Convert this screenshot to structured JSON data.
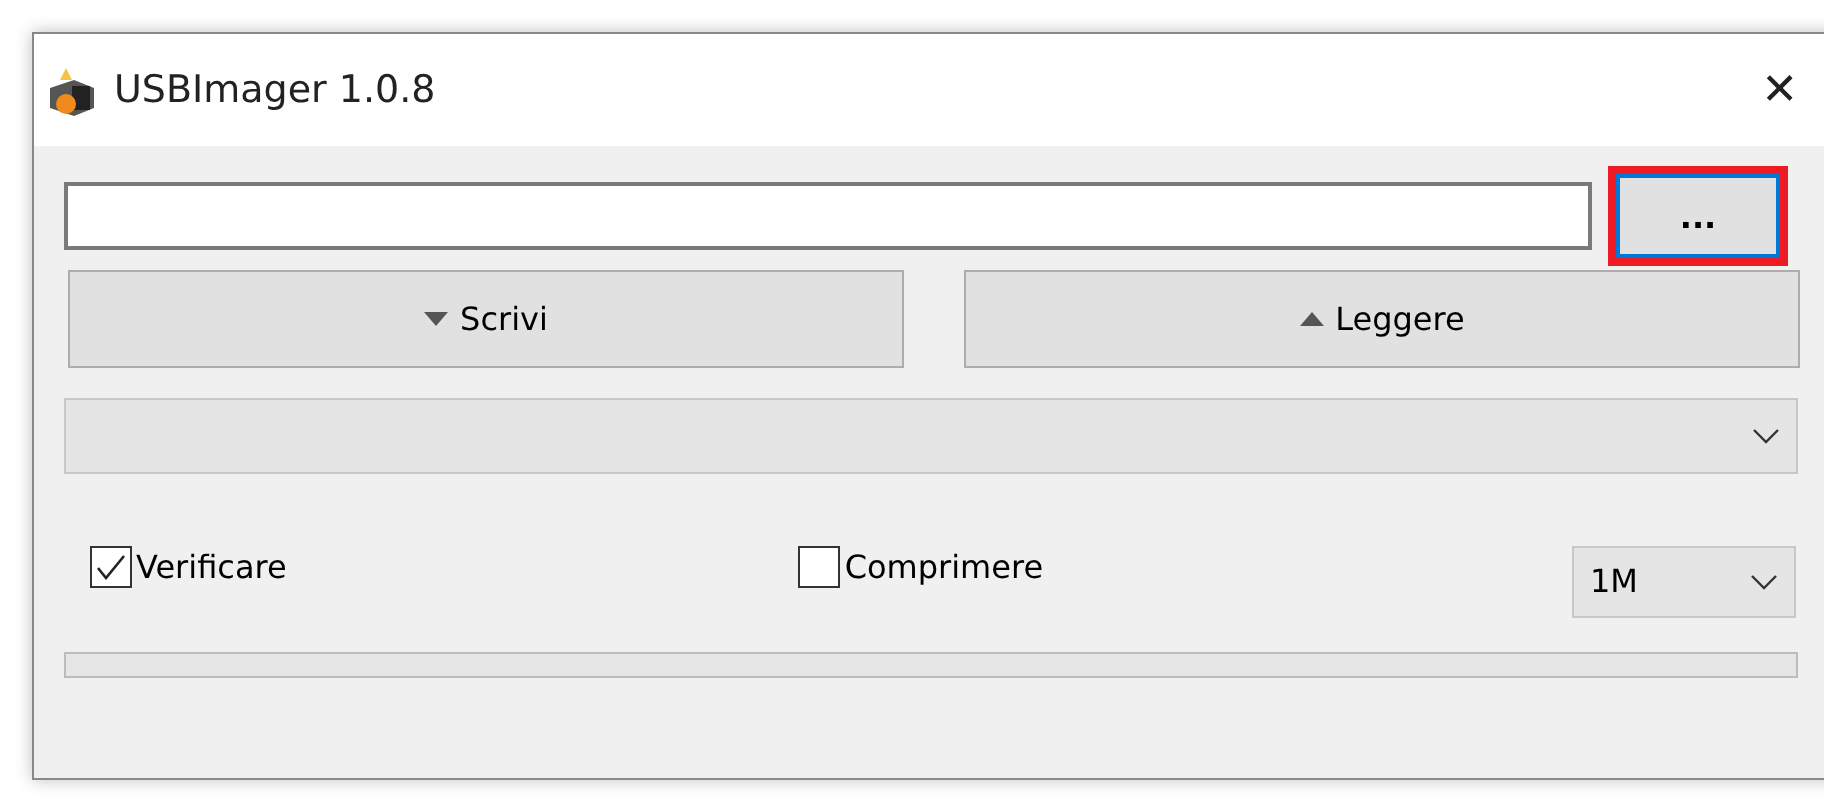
{
  "window": {
    "title": "USBImager 1.0.8",
    "close": "✕"
  },
  "browse_button": {
    "label": "...",
    "highlighted": true
  },
  "actions": [
    {
      "label": "Scrivi",
      "kind": "write"
    },
    {
      "label": "Leggere",
      "kind": "read"
    }
  ],
  "options": [
    {
      "label": "Verificare",
      "checked": true
    },
    {
      "label": "Comprimere",
      "checked": false
    }
  ],
  "buffer_select": {
    "value": "1M"
  },
  "progress": {
    "level": 0
  }
}
